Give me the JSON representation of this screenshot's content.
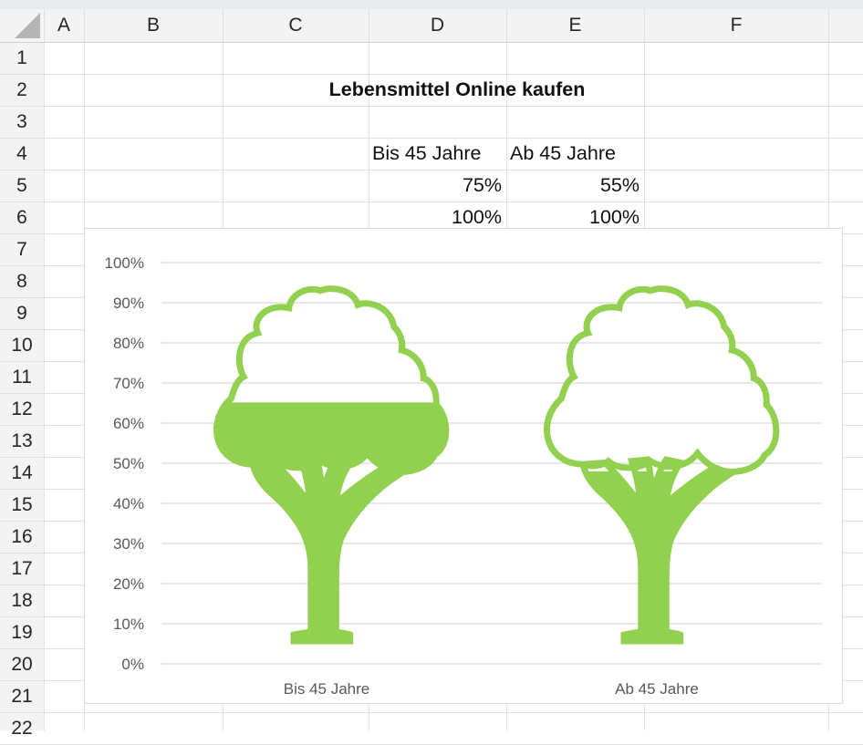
{
  "sheet": {
    "columns": [
      "A",
      "B",
      "C",
      "D",
      "E",
      "F"
    ],
    "rows": [
      "1",
      "2",
      "3",
      "4",
      "5",
      "6",
      "7",
      "8",
      "9",
      "10",
      "11",
      "12",
      "13",
      "14",
      "15",
      "16",
      "17",
      "18",
      "19",
      "20",
      "21",
      "22"
    ],
    "title": "Lebensmittel Online kaufen",
    "headers": [
      "Bis 45 Jahre",
      "Ab 45 Jahre"
    ],
    "row5": [
      "75%",
      "55%"
    ],
    "row6": [
      "100%",
      "100%"
    ]
  },
  "colors": {
    "fill": "#92d050",
    "outline": "#92d050",
    "gridline": "#d9d9d9",
    "axis_text": "#595959"
  },
  "chart_data": {
    "type": "bar",
    "categories": [
      "Bis 45 Jahre",
      "Ab 45 Jahre"
    ],
    "series": [
      {
        "values": [
          0.75,
          0.55
        ]
      },
      {
        "values": [
          1.0,
          1.0
        ]
      }
    ],
    "ylim": [
      0,
      1
    ],
    "yticks": [
      "0%",
      "10%",
      "20%",
      "30%",
      "40%",
      "50%",
      "60%",
      "70%",
      "80%",
      "90%",
      "100%"
    ],
    "grid": true,
    "marker": "tree-icon"
  }
}
